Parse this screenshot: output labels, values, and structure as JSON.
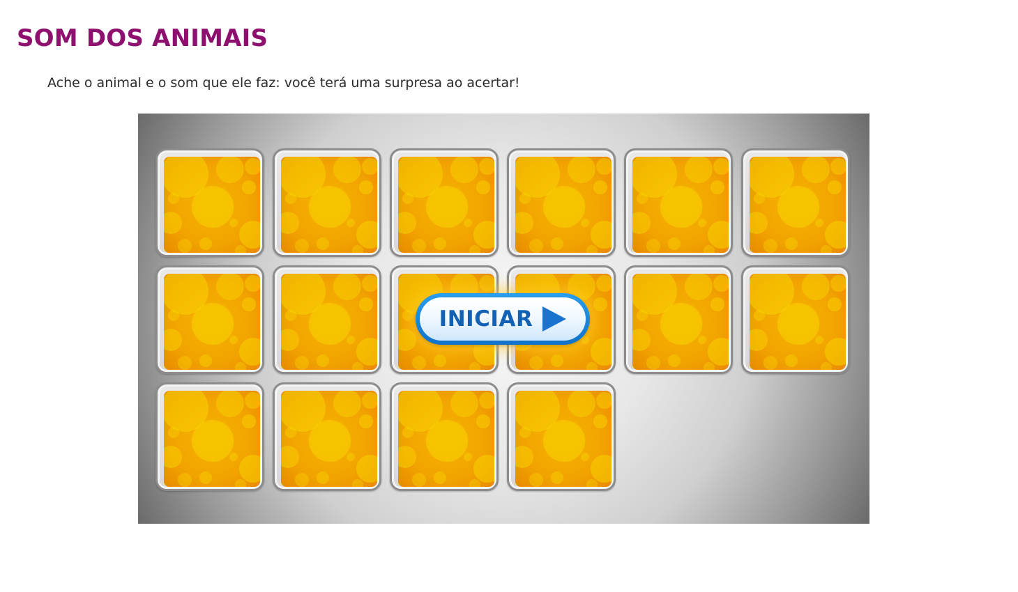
{
  "page": {
    "title": "SOM DOS ANIMAIS",
    "description": "Ache o animal e o som que ele faz: você terá uma surpresa ao acertar!"
  },
  "game": {
    "start_button": {
      "label": "INICIAR",
      "icon": "play-icon"
    },
    "cards": {
      "count": 16,
      "columns": 6,
      "state": "face-down"
    },
    "colors": {
      "title": "#8d0f6e",
      "card_back": "#f1a300",
      "button_blue": "#1261b5"
    }
  }
}
